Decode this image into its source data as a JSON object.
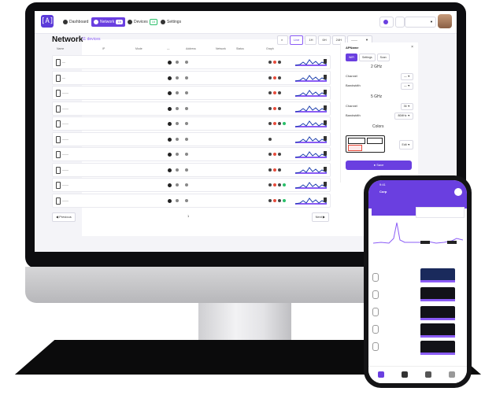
{
  "app": {
    "logo_text": "[A]",
    "nav": [
      {
        "label": "Dashboard"
      },
      {
        "label": "Network",
        "badge": "15",
        "active": true
      },
      {
        "label": "Devices",
        "badge": "15"
      },
      {
        "label": "Settings"
      }
    ],
    "colors": {
      "accent": "#6a3fe0",
      "badge_green": "#2bbf6a",
      "bg": "#f4f4f8"
    }
  },
  "network": {
    "title": "Network",
    "subtitle": "11 devices",
    "filters": [
      "Live",
      "1H",
      "6H",
      "24H"
    ],
    "dropdown_value": "——",
    "columns": [
      "Name",
      "IP",
      "Mode",
      "—",
      "Address",
      "Network",
      "Status",
      "Graph"
    ],
    "rows": [
      {
        "name": "—",
        "status": [
          "#444",
          "#e74c3c",
          "#444"
        ]
      },
      {
        "name": "—",
        "status": [
          "#444",
          "#e74c3c",
          "#444"
        ]
      },
      {
        "name": "——",
        "status": [
          "#444",
          "#e74c3c",
          "#444"
        ]
      },
      {
        "name": "——",
        "status": [
          "#444",
          "#e74c3c",
          "#444"
        ]
      },
      {
        "name": "——",
        "status": [
          "#444",
          "#e74c3c",
          "#444",
          "#2bbf6a"
        ]
      },
      {
        "name": "——",
        "status": [
          "#444"
        ]
      },
      {
        "name": "——",
        "status": [
          "#444",
          "#e74c3c",
          "#444"
        ]
      },
      {
        "name": "——",
        "status": [
          "#444",
          "#e74c3c",
          "#444"
        ]
      },
      {
        "name": "——",
        "status": [
          "#444",
          "#e74c3c",
          "#444",
          "#2bbf6a"
        ]
      },
      {
        "name": "——",
        "status": [
          "#444",
          "#e74c3c",
          "#444",
          "#2bbf6a"
        ]
      }
    ],
    "pager": {
      "prev": "Previous",
      "next": "Next",
      "page": "1"
    }
  },
  "panel": {
    "title": "APName",
    "close": "×",
    "tabs": [
      "WiFi",
      "Settings",
      "Scan"
    ],
    "band1": "2 GHz",
    "channel_label": "Channel",
    "channel_value": "—",
    "bandwidth_label": "Bandwidth",
    "bandwidth_value": "—",
    "band2": "5 GHz",
    "channel2_value": "36",
    "bandwidth2_value": "80MHz",
    "colors_label": "Colors",
    "color_select": "Edit",
    "save": "Save"
  },
  "phone": {
    "time": "9:41",
    "name": "Corp",
    "nav": [
      "Home",
      "Network",
      "Devices",
      "Settings"
    ]
  }
}
